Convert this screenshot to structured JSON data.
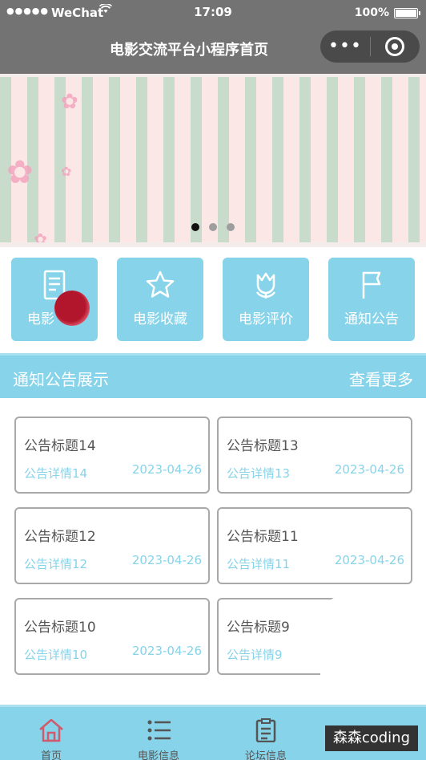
{
  "status_bar": {
    "signal": "●●●●●",
    "carrier": "WeChat",
    "time": "17:09",
    "battery": "100%"
  },
  "nav": {
    "title": "电影交流平台小程序首页",
    "more_glyph": "•••"
  },
  "banner": {
    "indicator_count": 3,
    "active_index": 0
  },
  "menu": [
    {
      "label": "电影",
      "icon": "document-icon"
    },
    {
      "label": "电影收藏",
      "icon": "star-icon"
    },
    {
      "label": "电影评价",
      "icon": "tulip-icon"
    },
    {
      "label": "通知公告",
      "icon": "flag-icon"
    }
  ],
  "notices_section": {
    "title": "通知公告展示",
    "more": "查看更多"
  },
  "notices": [
    {
      "title": "公告标题14",
      "detail": "公告详情14",
      "date": "2023-04-26"
    },
    {
      "title": "公告标题13",
      "detail": "公告详情13",
      "date": "2023-04-26"
    },
    {
      "title": "公告标题12",
      "detail": "公告详情12",
      "date": "2023-04-26"
    },
    {
      "title": "公告标题11",
      "detail": "公告详情11",
      "date": "2023-04-26"
    },
    {
      "title": "公告标题10",
      "detail": "公告详情10",
      "date": "2023-04-26"
    },
    {
      "title": "公告标题9",
      "detail": "公告详情9",
      "date": ""
    }
  ],
  "tabbar": [
    {
      "label": "首页",
      "icon": "home-icon"
    },
    {
      "label": "电影信息",
      "icon": "list-icon"
    },
    {
      "label": "论坛信息",
      "icon": "clipboard-icon"
    }
  ],
  "watermark": "森森coding",
  "colors": {
    "accent": "#86d3ea",
    "nav_bg": "#737373",
    "card_border": "#a9a9a9",
    "touch_indicator": "#b2162c"
  }
}
